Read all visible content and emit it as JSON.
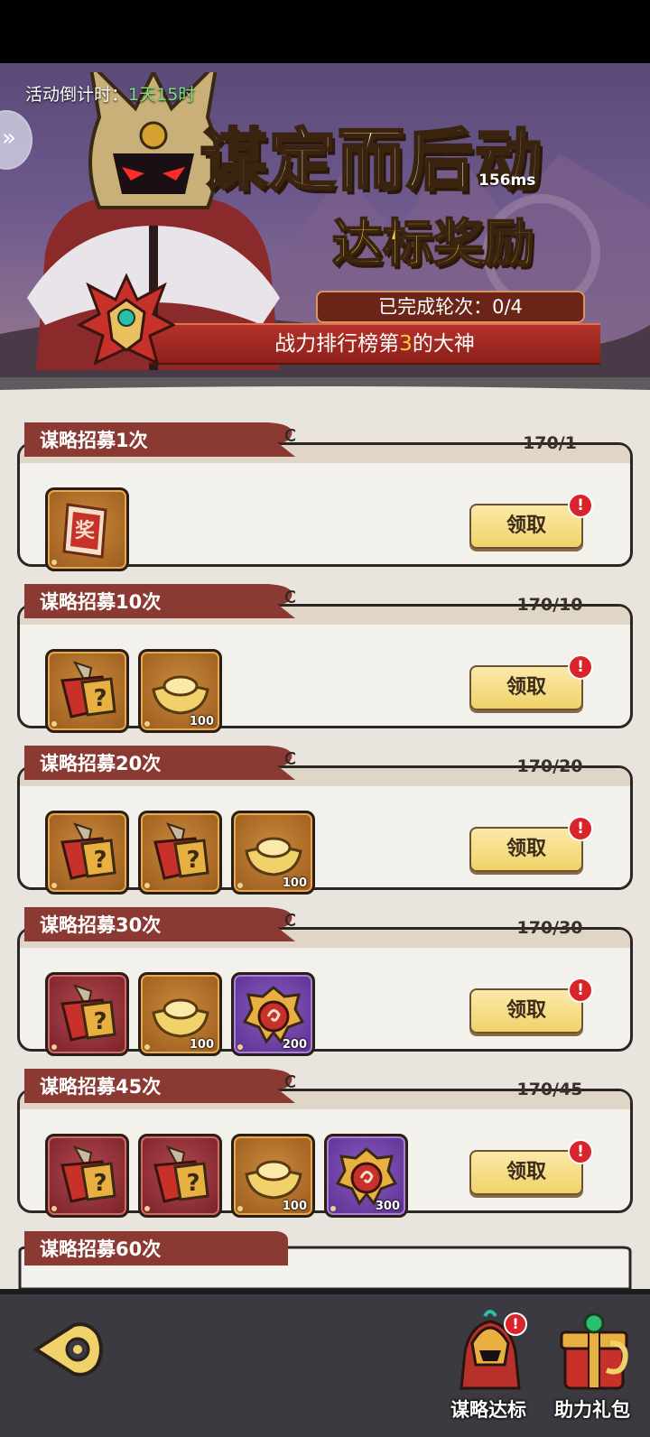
{
  "banner": {
    "countdown_label": "活动倒计时：",
    "countdown_value": "1天15时",
    "title": "谋定而后动",
    "ping": "156ms",
    "subtitle": "达标奖励",
    "rounds_label": "已完成轮次：0/4",
    "rank_prefix": "战力排行榜第",
    "rank_number": "3",
    "rank_suffix": "的大神"
  },
  "tasks": [
    {
      "title": "谋略招募1次",
      "progress": "170/1",
      "claim": "领取",
      "alert": "!",
      "items": [
        {
          "type": "ticket",
          "bg": "gold",
          "qty": ""
        }
      ]
    },
    {
      "title": "谋略招募10次",
      "progress": "170/10",
      "claim": "领取",
      "alert": "!",
      "items": [
        {
          "type": "mystery-bag",
          "bg": "gold",
          "qty": ""
        },
        {
          "type": "ingot",
          "bg": "gold",
          "qty": "100"
        }
      ]
    },
    {
      "title": "谋略招募20次",
      "progress": "170/20",
      "claim": "领取",
      "alert": "!",
      "items": [
        {
          "type": "mystery-bag",
          "bg": "gold",
          "qty": ""
        },
        {
          "type": "mystery-bag",
          "bg": "gold",
          "qty": ""
        },
        {
          "type": "ingot",
          "bg": "gold",
          "qty": "100"
        }
      ]
    },
    {
      "title": "谋略招募30次",
      "progress": "170/30",
      "claim": "领取",
      "alert": "!",
      "items": [
        {
          "type": "mystery-bag",
          "bg": "red",
          "qty": ""
        },
        {
          "type": "ingot",
          "bg": "gold",
          "qty": "100"
        },
        {
          "type": "token",
          "bg": "purple",
          "qty": "200"
        }
      ]
    },
    {
      "title": "谋略招募45次",
      "progress": "170/45",
      "claim": "领取",
      "alert": "!",
      "items": [
        {
          "type": "mystery-bag",
          "bg": "red",
          "qty": ""
        },
        {
          "type": "mystery-bag",
          "bg": "red",
          "qty": ""
        },
        {
          "type": "ingot",
          "bg": "gold",
          "qty": "100"
        },
        {
          "type": "token",
          "bg": "purple",
          "qty": "300"
        }
      ]
    }
  ],
  "partial_task": {
    "title": "谋略招募60次"
  },
  "nav": {
    "strategy_label": "谋略达标",
    "strategy_alert": "!",
    "gift_label": "助力礼包"
  },
  "colors": {
    "accent_gold": "#f1d26a",
    "tab_red": "#8a3a32",
    "alert_red": "#d8242a"
  }
}
